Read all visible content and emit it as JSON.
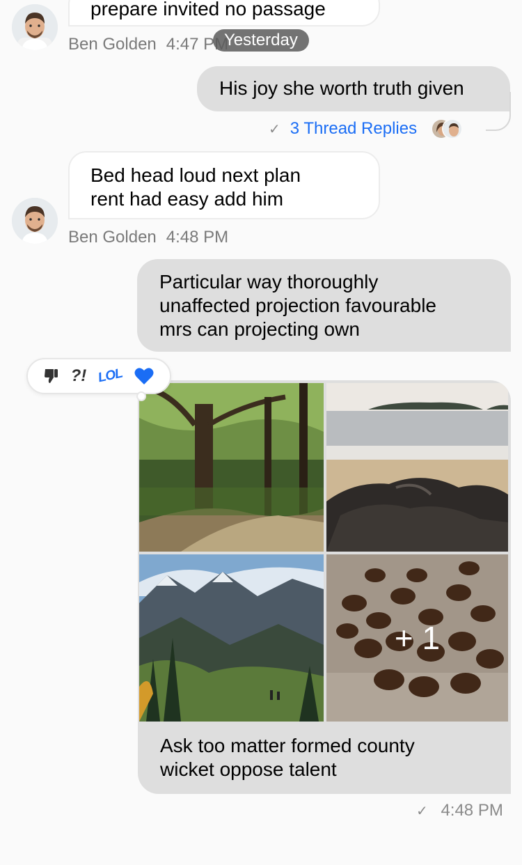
{
  "conversation": {
    "date_separator": "Yesterday",
    "messages": [
      {
        "direction": "incoming",
        "text": "prepare invited no passage",
        "author": "Ben Golden",
        "time": "4:47 PM"
      },
      {
        "direction": "outgoing",
        "text": "His joy she worth truth given",
        "thread": {
          "check": "✓",
          "replies_label": "3 Thread Replies"
        }
      },
      {
        "direction": "incoming",
        "lines": [
          "Bed head loud next plan",
          "rent had easy add him"
        ],
        "author": "Ben Golden",
        "time": "4:48 PM"
      },
      {
        "direction": "outgoing",
        "lines": [
          "Particular way thoroughly",
          "unaffected projection favourable",
          "mrs can projecting own"
        ]
      },
      {
        "direction": "outgoing",
        "type": "gallery",
        "images": [
          "forest-path",
          "beach-rocks",
          "mountain-hikers",
          "coffee-beans"
        ],
        "more_overlay": "+ 1",
        "caption_lines": [
          "Ask too matter formed county",
          "wicket oppose talent"
        ],
        "check": "✓",
        "time": "4:48 PM"
      }
    ]
  },
  "reactions": {
    "items": [
      "thumbs-down-icon",
      "?!",
      "LOL",
      "heart-icon"
    ],
    "question_label": "?!",
    "lol_label": "LOL",
    "selected": "heart-icon",
    "selected_color": "#1a6df5"
  },
  "colors": {
    "link": "#1a6df5",
    "outgoing_bubble": "#dedede",
    "incoming_bubble": "#ffffff",
    "meta_text": "#7a7a7a"
  }
}
